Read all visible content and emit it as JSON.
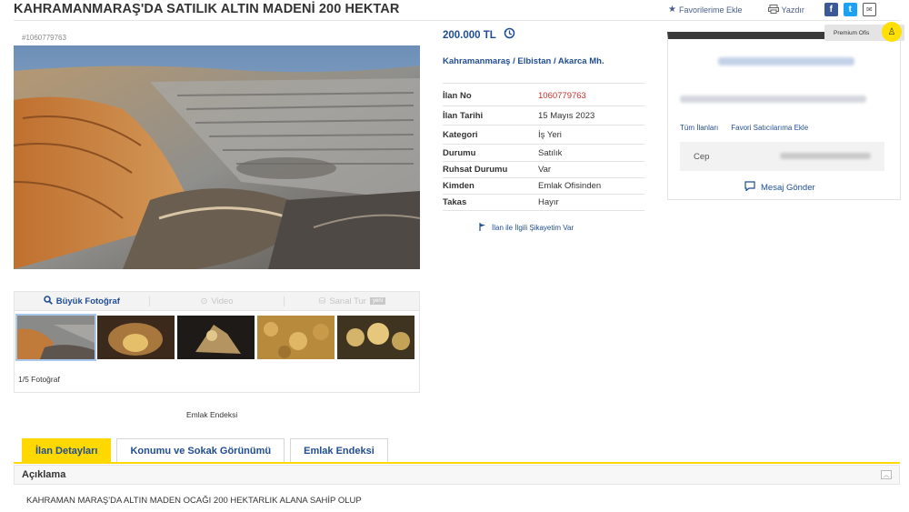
{
  "listing": {
    "title": "KAHRAMANMARAŞ'DA SATILIK ALTIN MADENİ 200 HEKTAR",
    "id_label": "#1060779763",
    "price": "200.000 TL",
    "location": "Kahramanmaraş / Elbistan / Akarca Mh."
  },
  "top_actions": {
    "favorite": "Favorilerime Ekle",
    "print": "Yazdır",
    "share_icons": [
      "facebook-icon",
      "twitter-icon",
      "mail-icon"
    ]
  },
  "details": [
    {
      "label": "İlan No",
      "value": "1060779763",
      "highlight": true
    },
    {
      "label": "İlan Tarihi",
      "value": "15 Mayıs 2023"
    },
    {
      "label": "Kategori",
      "value": "İş Yeri"
    },
    {
      "label": "Durumu",
      "value": "Satılık"
    },
    {
      "label": "Ruhsat Durumu",
      "value": "Var"
    },
    {
      "label": "Kimden",
      "value": "Emlak Ofisinden"
    },
    {
      "label": "Takas",
      "value": "Hayır"
    }
  ],
  "complaint_link": "İlan ile İlgili Şikayetim Var",
  "media": {
    "tabs": [
      "Büyük Fotoğraf",
      "Video",
      "Sanal Tur"
    ],
    "new_badge": "yeni",
    "photo_count": "1/5 Fotoğraf"
  },
  "emlak_endeksi_link": "Emlak Endeksi",
  "seller": {
    "premium_label": "Premium Ofis",
    "all_listings": "Tüm İlanları",
    "add_favorite": "Favori Satıcılarıma Ekle",
    "phone_label": "Cep",
    "message": "Mesaj Gönder"
  },
  "bottom_tabs": [
    "İlan Detayları",
    "Konumu ve Sokak Görünümü",
    "Emlak Endeksi"
  ],
  "description": {
    "title": "Açıklama",
    "text": "KAHRAMAN MARAŞ'DA ALTIN MADEN OCAĞI 200 HEKTARLIK ALANA SAHİP OLUP"
  },
  "colors": {
    "accent_blue": "#1f4d93",
    "highlight_red": "#c9302c",
    "tab_yellow": "#ffd800"
  }
}
